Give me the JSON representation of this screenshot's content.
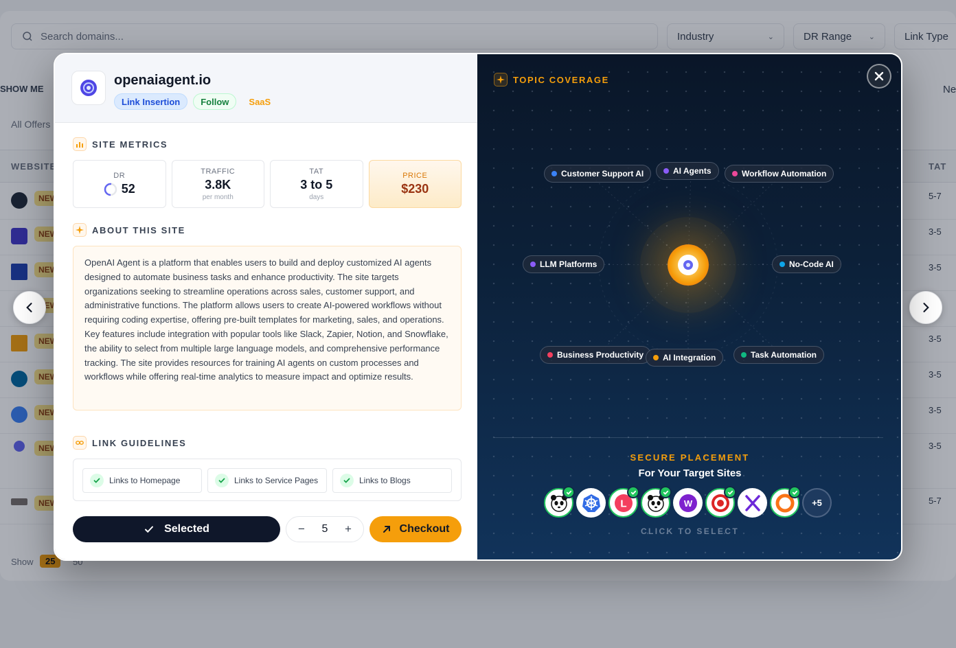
{
  "background": {
    "search_placeholder": "Search domains...",
    "filters": [
      "Industry",
      "DR Range",
      "Link Type"
    ],
    "show_me_label": "SHOW ME",
    "all_offers_label": "All Offers",
    "new_label_right": "Ne",
    "table_header_website": "WEBSITE",
    "table_header_tat": "TAT",
    "row_badge": "NEW",
    "row_tats": [
      "5-7",
      "3-5",
      "3-5",
      "3-5",
      "3-5",
      "3-5",
      "3-5",
      "3-5",
      "5-7"
    ],
    "show_label": "Show",
    "page_sizes": [
      "25",
      "50"
    ]
  },
  "site": {
    "name": "openaiagent.io",
    "tags": [
      "Link Insertion",
      "Follow",
      "SaaS"
    ]
  },
  "metrics": {
    "section_title": "SITE METRICS",
    "dr_label": "DR",
    "dr_value": "52",
    "traffic_label": "TRAFFIC",
    "traffic_value": "3.8K",
    "traffic_sub": "per month",
    "tat_label": "TAT",
    "tat_value": "3 to 5",
    "tat_sub": "days",
    "price_label": "PRICE",
    "price_value": "$230"
  },
  "about": {
    "section_title": "ABOUT THIS SITE",
    "text": "OpenAI Agent is a platform that enables users to build and deploy customized AI agents designed to automate business tasks and enhance productivity. The site targets organizations seeking to streamline operations across sales, customer support, and administrative functions. The platform allows users to create AI-powered workflows without requiring coding expertise, offering pre-built templates for marketing, sales, and operations. Key features include integration with popular tools like Slack, Zapier, Notion, and Snowflake, the ability to select from multiple large language models, and comprehensive performance tracking. The site provides resources for training AI agents on custom processes and workflows while offering real-time analytics to measure impact and optimize results."
  },
  "guidelines": {
    "section_title": "LINK GUIDELINES",
    "items": [
      "Links to Homepage",
      "Links to Service Pages",
      "Links to Blogs"
    ]
  },
  "actions": {
    "selected_label": "Selected",
    "quantity": "5",
    "minus": "−",
    "plus": "+",
    "checkout_label": "Checkout"
  },
  "topics": {
    "section_title": "TOPIC COVERAGE",
    "items": [
      {
        "label": "Customer Support AI",
        "color": "#3b82f6"
      },
      {
        "label": "AI Agents",
        "color": "#8b5cf6"
      },
      {
        "label": "Workflow Automation",
        "color": "#ec4899"
      },
      {
        "label": "LLM Platforms",
        "color": "#8b5cf6"
      },
      {
        "label": "No-Code AI",
        "color": "#0ea5e9"
      },
      {
        "label": "Business Productivity",
        "color": "#f43f5e"
      },
      {
        "label": "AI Integration",
        "color": "#f59e0b"
      },
      {
        "label": "Task Automation",
        "color": "#10b981"
      }
    ]
  },
  "placement": {
    "title": "SECURE PLACEMENT",
    "subtitle": "For Your Target Sites",
    "more_count": "+5",
    "hint": "CLICK TO SELECT"
  },
  "colors": {
    "accent": "#f59e0b",
    "dark_button": "#0f172a",
    "success": "#22c55e"
  }
}
